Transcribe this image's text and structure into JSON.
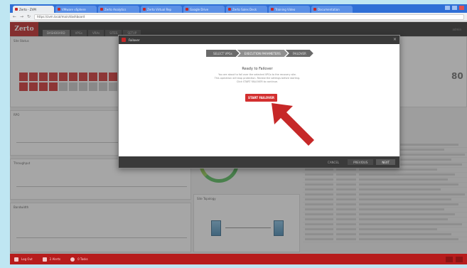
{
  "browser": {
    "tabs": [
      {
        "label": "Zerto - ZVM",
        "active": true
      },
      {
        "label": "VMware vSphere",
        "active": false
      },
      {
        "label": "Zerto Analytics",
        "active": false
      },
      {
        "label": "Zerto Virtual Rep",
        "active": false
      },
      {
        "label": "Google Drive",
        "active": false
      },
      {
        "label": "Zerto Sales Deck",
        "active": false
      },
      {
        "label": "Training Video",
        "active": false
      },
      {
        "label": "Documentation",
        "active": false
      }
    ],
    "url": "https://zvm.local/main/dashboard"
  },
  "app": {
    "logo": "Zerto",
    "tabs": [
      "DASHBOARD",
      "VPGs",
      "VRAs",
      "SITES",
      "SETUP"
    ],
    "active_tab": "DASHBOARD",
    "header_right": "admin"
  },
  "dashboard": {
    "status_title": "Site Status",
    "metric_right": "80",
    "panels": [
      "RPO",
      "Throughput",
      "Bandwidth"
    ],
    "topology_title": "Site Topology"
  },
  "modal": {
    "title": "Failover",
    "steps": [
      "SELECT VPGs",
      "EXECUTION PARAMETERS",
      "FAILOVER"
    ],
    "active_step": 2,
    "body_title": "Ready to Failover",
    "body_lines": [
      "You are about to fail over the selected VPGs to the recovery site.",
      "This operation will stop protection. Review the settings before starting.",
      "Click START FAILOVER to continue."
    ],
    "start_button": "START FAILOVER",
    "footer_buttons": [
      "CANCEL",
      "PREVIOUS",
      "NEXT"
    ]
  },
  "statusbar": {
    "items": [
      "Log Out",
      "2 Alerts",
      "0 Tasks"
    ]
  },
  "colors": {
    "brand": "#b71c1c",
    "accent": "#d32f2f",
    "arrow": "#c62828"
  }
}
